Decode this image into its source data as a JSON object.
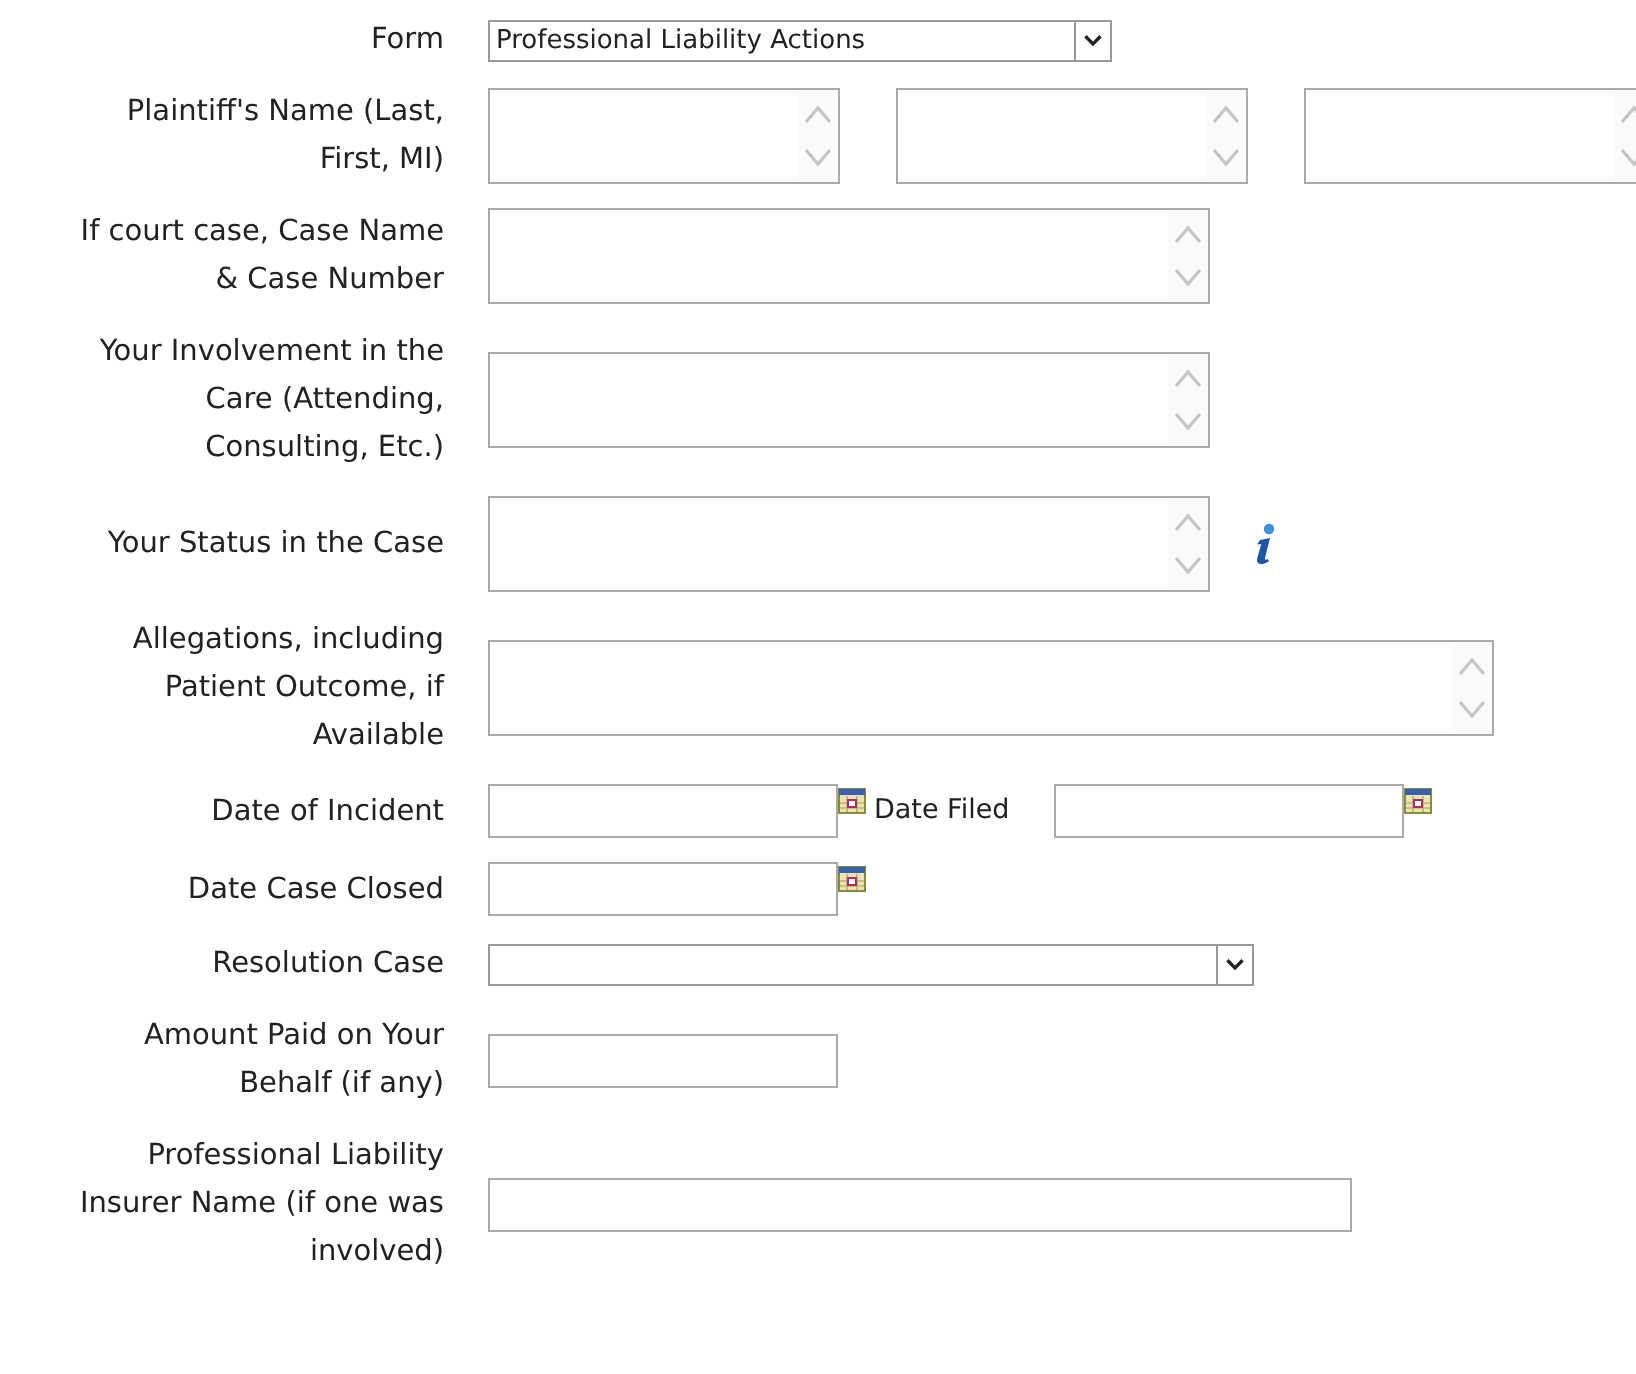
{
  "fields": [
    {
      "kind": "select",
      "label": "Form",
      "value": "Professional Liability Actions"
    },
    {
      "kind": "textarea-triple",
      "label": "Plaintiff's Name (Last,\nFirst, MI)"
    },
    {
      "kind": "textarea",
      "label": "If court case, Case Name\n& Case Number"
    },
    {
      "kind": "textarea",
      "label": "Your Involvement in the\nCare (Attending,\nConsulting, Etc.)"
    },
    {
      "kind": "textarea",
      "label": "Your Status in the Case",
      "info": true
    },
    {
      "kind": "textarea-wide",
      "label": "Allegations, including\nPatient Outcome, if\nAvailable"
    },
    {
      "kind": "date-pair",
      "label": "Date of Incident",
      "second_label": "Date Filed"
    },
    {
      "kind": "date",
      "label": "Date Case Closed"
    },
    {
      "kind": "select-wide",
      "label": "Resolution Case"
    },
    {
      "kind": "input-short",
      "label": "Amount Paid on Your\nBehalf (if any)"
    },
    {
      "kind": "input-long",
      "label": "Professional Liability\nInsurer Name (if one was\ninvolved)"
    }
  ]
}
